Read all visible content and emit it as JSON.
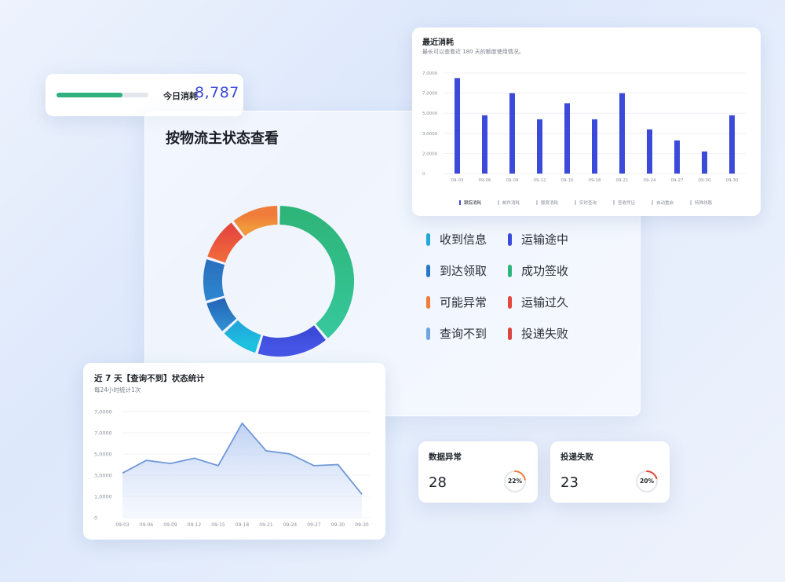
{
  "today": {
    "label": "今日消耗",
    "value": "8,787",
    "progress": 0.72,
    "bar_color": "#2eb07f"
  },
  "main": {
    "title": "按物流主状态查看",
    "legend": [
      {
        "label": "收到信息",
        "color": "#21a9dc"
      },
      {
        "label": "运输途中",
        "color": "#3b4ad8"
      },
      {
        "label": "到达领取",
        "color": "#2879c6"
      },
      {
        "label": "成功签收",
        "color": "#2eb57a"
      },
      {
        "label": "可能异常",
        "color": "#ef7c3a"
      },
      {
        "label": "运输过久",
        "color": "#e5483d"
      },
      {
        "label": "查询不到",
        "color": "#6ea7de"
      },
      {
        "label": "投递失败",
        "color": "#d9463f"
      }
    ]
  },
  "recent": {
    "title": "最近消耗",
    "subtitle": "最长可以查看近 180 天的额度使用情况。",
    "series_legend": [
      "跟踪消耗",
      "邮件消耗",
      "额度消耗",
      "实时查询",
      "签收凭证",
      "自动重启",
      "特殊线路"
    ]
  },
  "week": {
    "title": "近 7 天【查询不到】状态统计",
    "subtitle": "每24小时统计1次"
  },
  "stats": [
    {
      "title": "数据异常",
      "value": "28",
      "percent_label": "22%",
      "percent": 0.22,
      "color": "#ef7c3a"
    },
    {
      "title": "投递失败",
      "value": "23",
      "percent_label": "20%",
      "percent": 0.2,
      "color": "#e5483d"
    }
  ],
  "chart_data": [
    {
      "type": "pie",
      "variant": "donut",
      "title": "按物流主状态查看",
      "categories": [
        "成功签收",
        "运输途中",
        "收到信息",
        "到达领取",
        "可能异常",
        "运输过久",
        "查询不到",
        "投递失败"
      ],
      "segments": [
        {
          "label": "成功签收",
          "value": 37,
          "color_top": "#2eb57a",
          "color_bottom": "#36c79a"
        },
        {
          "label": "运输途中",
          "value": 15,
          "color_top": "#3b4ad8",
          "color_bottom": "#4755e6"
        },
        {
          "label": "收到信息",
          "value": 8,
          "color_top": "#21a9dc",
          "color_bottom": "#1ec0e0"
        },
        {
          "label": "到达领取",
          "value": 7,
          "color_top": "#2466b6",
          "color_bottom": "#2f8ad0"
        },
        {
          "label": "到达领取",
          "value": 9,
          "color_top": "#2a70bf",
          "color_bottom": "#2e86cf"
        },
        {
          "label": "运输过久",
          "value": 9,
          "color_top": "#e5483d",
          "color_bottom": "#f06a3c"
        },
        {
          "label": "可能异常",
          "value": 10,
          "color_top": "#ef7c3a",
          "color_bottom": "#f09a3c"
        }
      ]
    },
    {
      "type": "bar",
      "title": "最近消耗",
      "categories": [
        "09-03",
        "09-06",
        "09-09",
        "09-12",
        "09-15",
        "09-18",
        "09-21",
        "09-24",
        "09-27",
        "09-30",
        "09-30"
      ],
      "series": [
        {
          "name": "跟踪消耗",
          "values": [
            9500,
            5800,
            8000,
            5400,
            7000,
            5400,
            8000,
            4400,
            3300,
            2200,
            5800
          ],
          "color": "#3b4ad8"
        }
      ],
      "yticks": [
        "0",
        "2,0000",
        "3,0000",
        "5,0000",
        "7,0000",
        "7,0000"
      ],
      "ylim": [
        0,
        10000
      ]
    },
    {
      "type": "area",
      "title": "近 7 天【查询不到】状态统计",
      "categories": [
        "09-03",
        "09-06",
        "09-09",
        "09-12",
        "09-15",
        "09-18",
        "09-21",
        "09-24",
        "09-27",
        "09-30",
        "09-30"
      ],
      "series": [
        {
          "values": [
            4200,
            5400,
            5100,
            5600,
            4900,
            8900,
            6300,
            6000,
            4900,
            5000,
            2200
          ],
          "color": "#6f98d8"
        }
      ],
      "yticks": [
        "0",
        "1,0000",
        "3,0000",
        "5,0000",
        "7,0000",
        "7,0000"
      ],
      "ylim": [
        0,
        10000
      ]
    }
  ]
}
